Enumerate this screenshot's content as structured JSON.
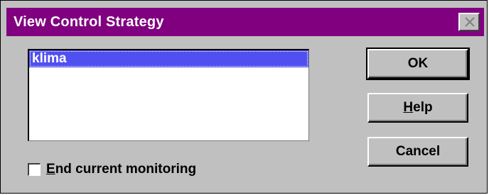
{
  "window": {
    "title": "View Control Strategy",
    "title_bar_color": "#800080",
    "close_icon": "close-icon"
  },
  "strategy_list": {
    "items": [
      {
        "label": "klima",
        "selected": true
      }
    ],
    "selection_color": "#5050f0"
  },
  "options": {
    "end_monitoring": {
      "mnemonic": "E",
      "label_rest": "nd current monitoring",
      "checked": false
    }
  },
  "buttons": {
    "ok": {
      "label": "OK"
    },
    "help": {
      "mnemonic": "H",
      "label_rest": "elp"
    },
    "cancel": {
      "label": "Cancel"
    }
  }
}
